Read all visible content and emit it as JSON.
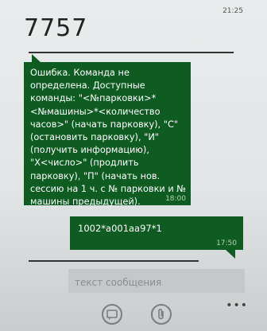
{
  "status_bar": {
    "time": "21:25"
  },
  "header": {
    "contact": "7757"
  },
  "messages": [
    {
      "direction": "incoming",
      "text": "Ошибка. Команда не определена. Доступные команды: \"<№парковки>*<№машины>*<количество часов>\" (начать парковку), \"С\" (остановить парковку), \"И\" (получить информацию), \"Х<число>\" (продлить парковку), \"П\" (начать нов. сессию на 1 ч. с № парковки и № машины предыдущей).",
      "time": "18:00"
    },
    {
      "direction": "outgoing",
      "text": "1002*a001aa97*1",
      "time": "17:50"
    }
  ],
  "compose": {
    "placeholder": "текст сообщения"
  },
  "app_bar": {
    "buttons": [
      "send-icon",
      "attach-icon"
    ],
    "more": "•••"
  },
  "colors": {
    "bubble": "#0f5c23",
    "background": "#e5e8e8"
  }
}
